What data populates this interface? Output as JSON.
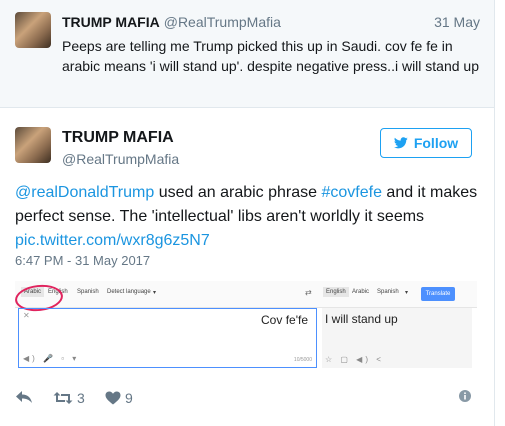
{
  "parent_tweet": {
    "name": "TRUMP MAFIA",
    "handle": "@RealTrumpMafia",
    "date": "31 May",
    "text": "Peeps are telling me Trump picked this up in Saudi. cov fe fe in arabic means 'i will stand up'. despite negative press..i will stand up"
  },
  "main_tweet": {
    "name": "TRUMP MAFIA",
    "handle": "@RealTrumpMafia",
    "follow_label": "Follow",
    "text_mention": "@realDonaldTrump",
    "text_part1": " used an arabic phrase ",
    "text_hashtag": "#covfefe",
    "text_part2": " and it makes perfect sense. The 'intellectual' libs aren't worldly it seems ",
    "text_link": "pic.twitter.com/wxr8g6z5N7",
    "timestamp": "6:47 PM - 31 May 2017"
  },
  "translate_image": {
    "source_langs": [
      "Arabic",
      "English",
      "Spanish",
      "Detect language"
    ],
    "target_langs": [
      "English",
      "Arabic",
      "Spanish"
    ],
    "translate_button": "Translate",
    "source_text": "Cov fe'fe",
    "target_text": "I will stand up",
    "char_count": "10/5000"
  },
  "actions": {
    "retweet_count": "3",
    "like_count": "9"
  },
  "colors": {
    "accent": "#1da1f2",
    "link": "#1b95e0",
    "muted": "#657786",
    "highlight_circle": "#e0245e"
  }
}
